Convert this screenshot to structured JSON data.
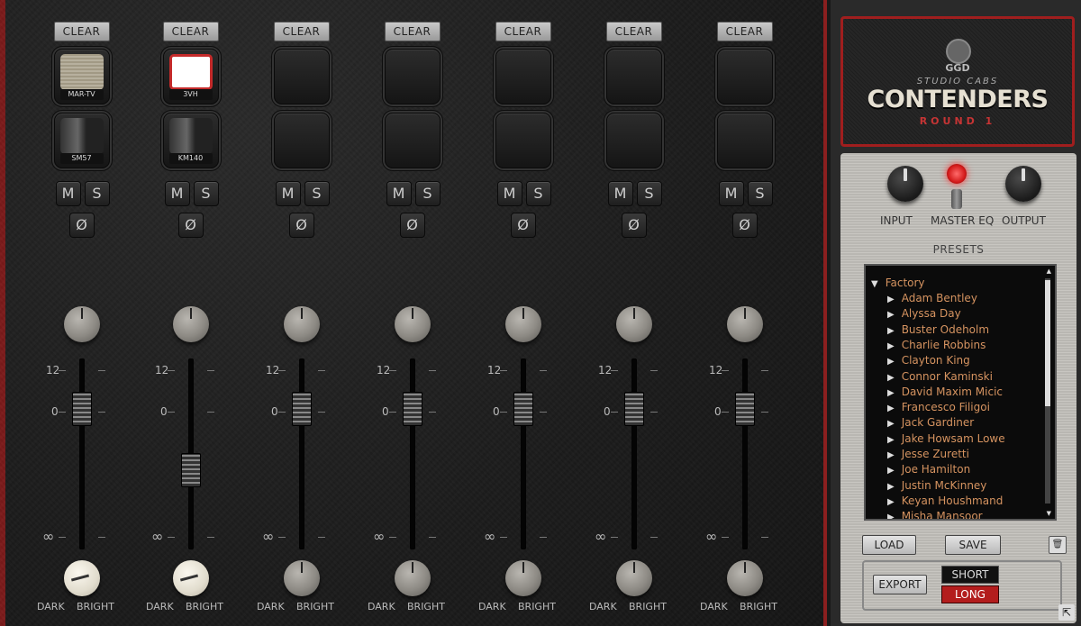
{
  "channels": [
    {
      "clear": "CLEAR",
      "cab": "MAR-TV",
      "mic": "SM57",
      "cab_style": "grille",
      "fader": 0.74,
      "tone": "white"
    },
    {
      "clear": "CLEAR",
      "cab": "3VH",
      "mic": "KM140",
      "cab_style": "grille-red",
      "fader": 0.42,
      "tone": "white"
    },
    {
      "clear": "CLEAR",
      "cab": "",
      "mic": "",
      "cab_style": "",
      "fader": 0.74,
      "tone": "grey"
    },
    {
      "clear": "CLEAR",
      "cab": "",
      "mic": "",
      "cab_style": "",
      "fader": 0.74,
      "tone": "grey"
    },
    {
      "clear": "CLEAR",
      "cab": "",
      "mic": "",
      "cab_style": "",
      "fader": 0.74,
      "tone": "grey"
    },
    {
      "clear": "CLEAR",
      "cab": "",
      "mic": "",
      "cab_style": "",
      "fader": 0.74,
      "tone": "grey"
    },
    {
      "clear": "CLEAR",
      "cab": "",
      "mic": "",
      "cab_style": "",
      "fader": 0.74,
      "tone": "grey"
    }
  ],
  "labels": {
    "mute": "M",
    "solo": "S",
    "phase": "Ø",
    "scale_top": "12",
    "scale_mid": "0",
    "scale_bottom": "∞",
    "dark": "DARK",
    "bright": "BRIGHT"
  },
  "logo": {
    "brand": "GGD",
    "sub": "STUDIO CABS",
    "title": "CONTENDERS",
    "round": "ROUND 1"
  },
  "master": {
    "input": "INPUT",
    "master_eq": "MASTER EQ",
    "output": "OUTPUT",
    "presets_title": "PRESETS"
  },
  "presets": {
    "folder": "Factory",
    "items": [
      "Adam Bentley",
      "Alyssa Day",
      "Buster Odeholm",
      "Charlie Robbins",
      "Clayton King",
      "Connor Kaminski",
      "David Maxim Micic",
      "Francesco Filigoi",
      "Jack Gardiner",
      "Jake Howsam Lowe",
      "Jesse Zuretti",
      "Joe Hamilton",
      "Justin McKinney",
      "Keyan Houshmand",
      "Misha Mansoor"
    ]
  },
  "buttons": {
    "load": "LOAD",
    "save": "SAVE",
    "export": "EXPORT",
    "short": "SHORT",
    "long": "LONG",
    "trash": "🗑",
    "expand": "⇱"
  },
  "colors": {
    "accent": "#a01e1e",
    "preset_text": "#d59360"
  }
}
